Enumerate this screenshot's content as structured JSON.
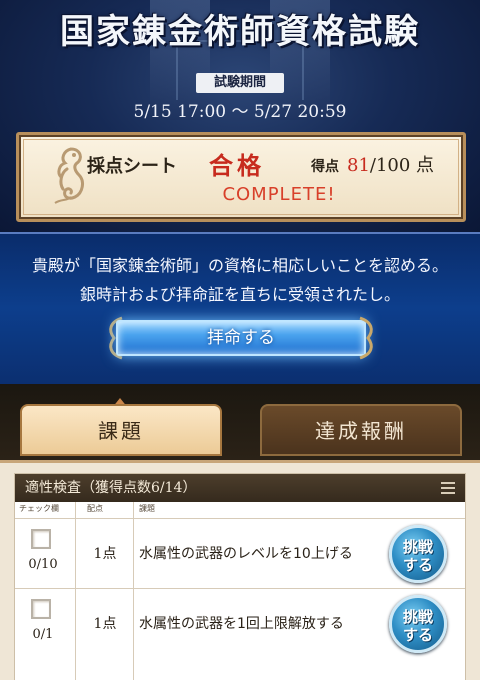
{
  "header": {
    "title": "国家錬金術師資格試験",
    "period_label": "試験期間",
    "period_dates": "5/15 17:00 〜 5/27 20:59"
  },
  "score_card": {
    "sheet_label": "採点シート",
    "result": "合格",
    "points_label": "得点",
    "score_value": "81",
    "score_max": "/100 点",
    "status": "COMPLETE!"
  },
  "message": {
    "line1": "貴殿が「国家錬金術師」の資格に相応しいことを認める。",
    "line2": "銀時計および拝命証を直ちに受領されたし。",
    "accept_button": "拝命する"
  },
  "tabs": [
    {
      "label": "課題",
      "active": true
    },
    {
      "label": "達成報酬",
      "active": false
    }
  ],
  "task_panel": {
    "title": "適性検査（獲得点数6/14）",
    "columns": [
      "チェック欄",
      "配点",
      "課題"
    ],
    "rows": [
      {
        "progress": "0/10",
        "points": "1点",
        "description": "水属性の武器のレベルを10上げる",
        "button_line1": "挑戦",
        "button_line2": "する"
      },
      {
        "progress": "0/1",
        "points": "1点",
        "description": "水属性の武器を1回上限解放する",
        "button_line1": "挑戦",
        "button_line2": "する"
      }
    ]
  },
  "colors": {
    "pass_red": "#c72b1e",
    "banner_blue": "#0d3e8c",
    "accept_glow": "#6fc0ff",
    "tab_active": "#eccb97",
    "tab_inactive": "#4b331d"
  },
  "icons": [
    "seahorse-emblem-icon",
    "menu-lines-icon",
    "checkbox-icon"
  ]
}
